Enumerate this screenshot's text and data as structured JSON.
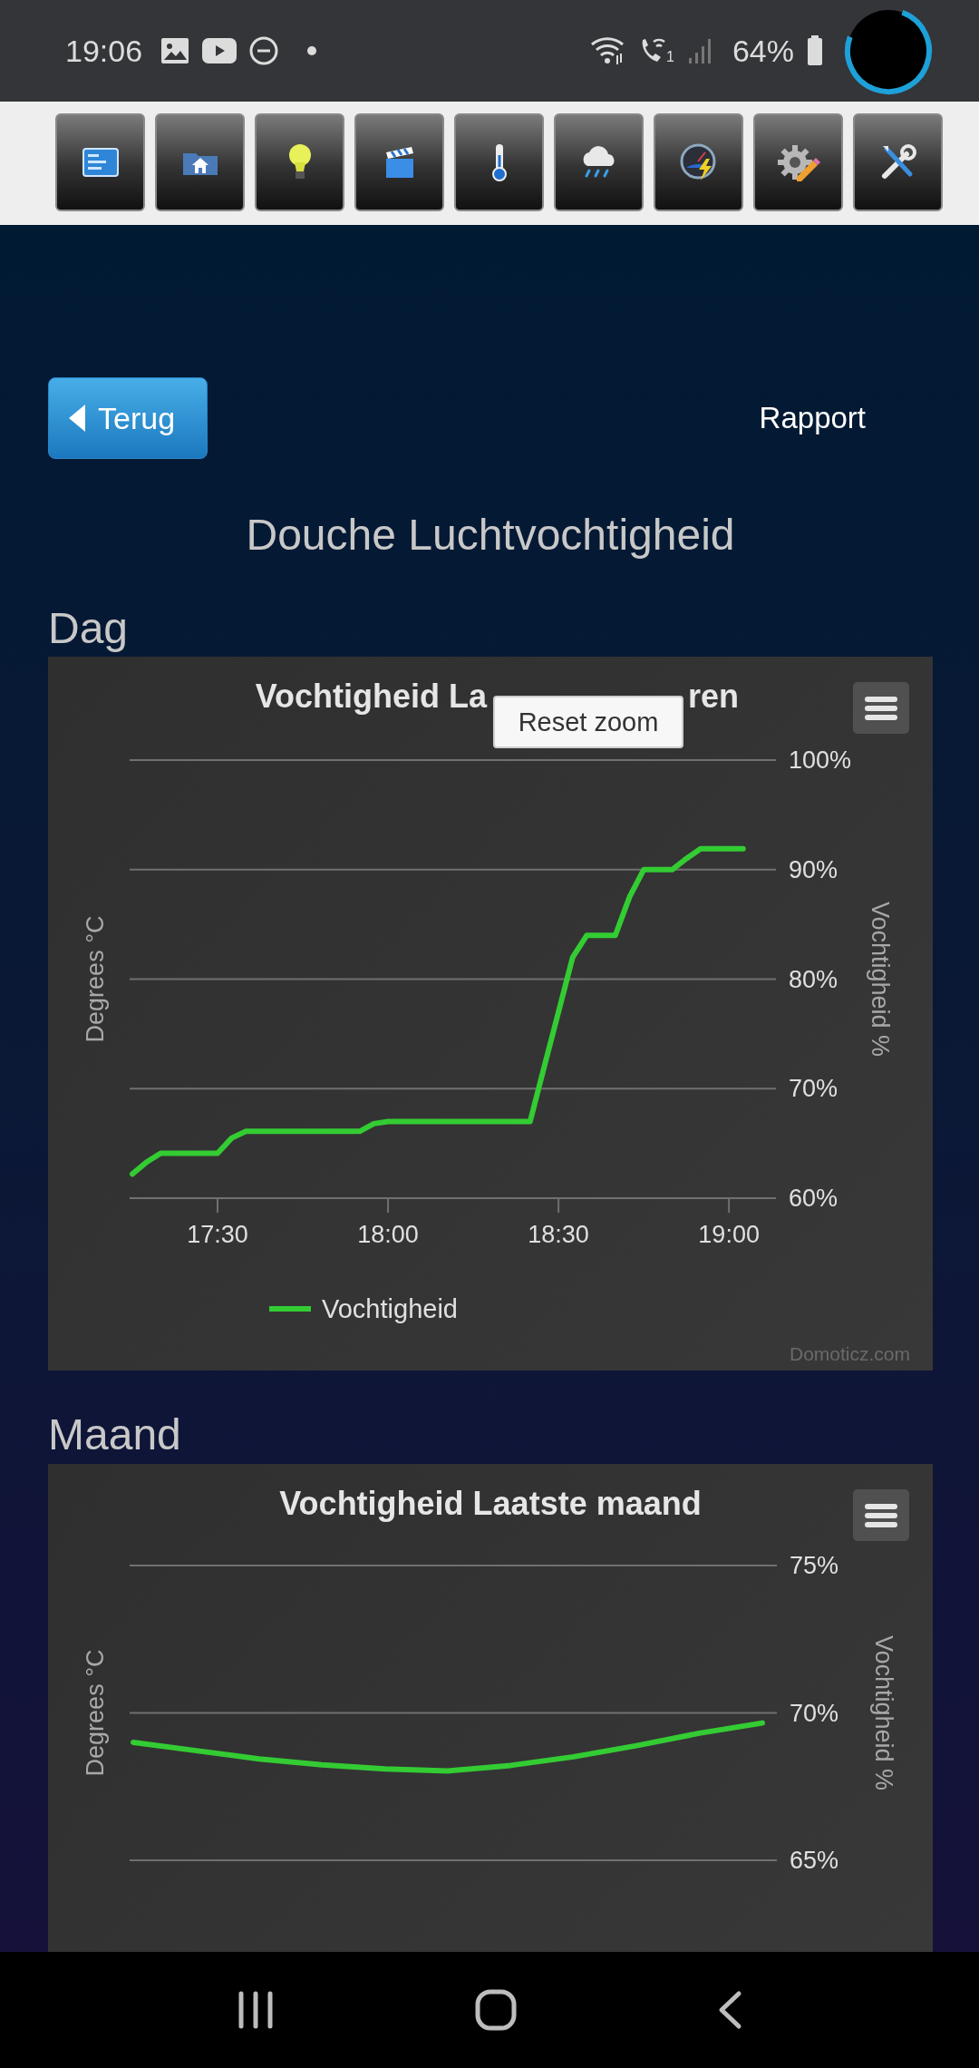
{
  "status_bar": {
    "time": "19:06",
    "call_badge": "1",
    "battery": "64%"
  },
  "toolbar": {
    "buttons": [
      {
        "kind": "dashboard"
      },
      {
        "kind": "house"
      },
      {
        "kind": "bulb"
      },
      {
        "kind": "clapper"
      },
      {
        "kind": "thermometer"
      },
      {
        "kind": "rain"
      },
      {
        "kind": "gauge"
      },
      {
        "kind": "gear"
      },
      {
        "kind": "tools"
      }
    ]
  },
  "header": {
    "back_button": "Terug",
    "report_link": "Rapport"
  },
  "page_title": "Douche Luchtvochtigheid",
  "cards": [
    {
      "heading": "Dag",
      "title_parts": [
        "Vochtigheid La",
        "ren"
      ],
      "reset_zoom": "Reset zoom",
      "left_axis_label": "Degrees °C",
      "credit": "Domoticz.com",
      "chart_data": {
        "type": "line",
        "grid": true,
        "ylabel": "Vochtigheid %",
        "ylim": [
          60,
          100
        ],
        "yticks": [
          {
            "value": 60,
            "label": "60%"
          },
          {
            "value": 70,
            "label": "70%"
          },
          {
            "value": 80,
            "label": "80%"
          },
          {
            "value": 90,
            "label": "90%"
          },
          {
            "value": 100,
            "label": "100%"
          }
        ],
        "categories": [
          null,
          null,
          null,
          null,
          null,
          null,
          "17:30",
          null,
          null,
          null,
          null,
          null,
          null,
          null,
          null,
          null,
          null,
          null,
          "18:00",
          null,
          null,
          null,
          null,
          null,
          null,
          null,
          null,
          null,
          null,
          null,
          "18:30",
          null,
          null,
          null,
          null,
          null,
          null,
          null,
          null,
          null,
          null,
          null,
          "19:00",
          null
        ],
        "series": [
          {
            "name": "Vochtigheid",
            "color": "#33cc33",
            "values": [
              62.2,
              63.3,
              64.1,
              64.1,
              64.1,
              64.1,
              64.1,
              65.5,
              66.1,
              66.1,
              66.1,
              66.1,
              66.1,
              66.1,
              66.1,
              66.1,
              66.1,
              66.8,
              67,
              67,
              67,
              67,
              67,
              67,
              67,
              67,
              67,
              67,
              67,
              72,
              77,
              82,
              84,
              84,
              84,
              87.5,
              90,
              90,
              90,
              91,
              91.9,
              91.9,
              91.9,
              91.9
            ]
          }
        ]
      }
    },
    {
      "heading": "Maand",
      "title_parts": [
        "Vochtigheid Laatste maand"
      ],
      "left_axis_label": "Degrees °C",
      "chart_data": {
        "type": "line",
        "grid": true,
        "ylabel": "Vochtigheid %",
        "ylim": [
          65,
          75
        ],
        "yticks": [
          {
            "value": 65,
            "label": "65%"
          },
          {
            "value": 70,
            "label": "70%"
          },
          {
            "value": 75,
            "label": "75%"
          }
        ],
        "categories": [
          null,
          null,
          null,
          null,
          null,
          null,
          null,
          null,
          null,
          null,
          null
        ],
        "series": [
          {
            "color": "#33cc33",
            "values": [
              69.0,
              68.72,
              68.44,
              68.24,
              68.1,
              68.03,
              68.22,
              68.51,
              68.89,
              69.31,
              69.66
            ]
          }
        ]
      }
    }
  ]
}
